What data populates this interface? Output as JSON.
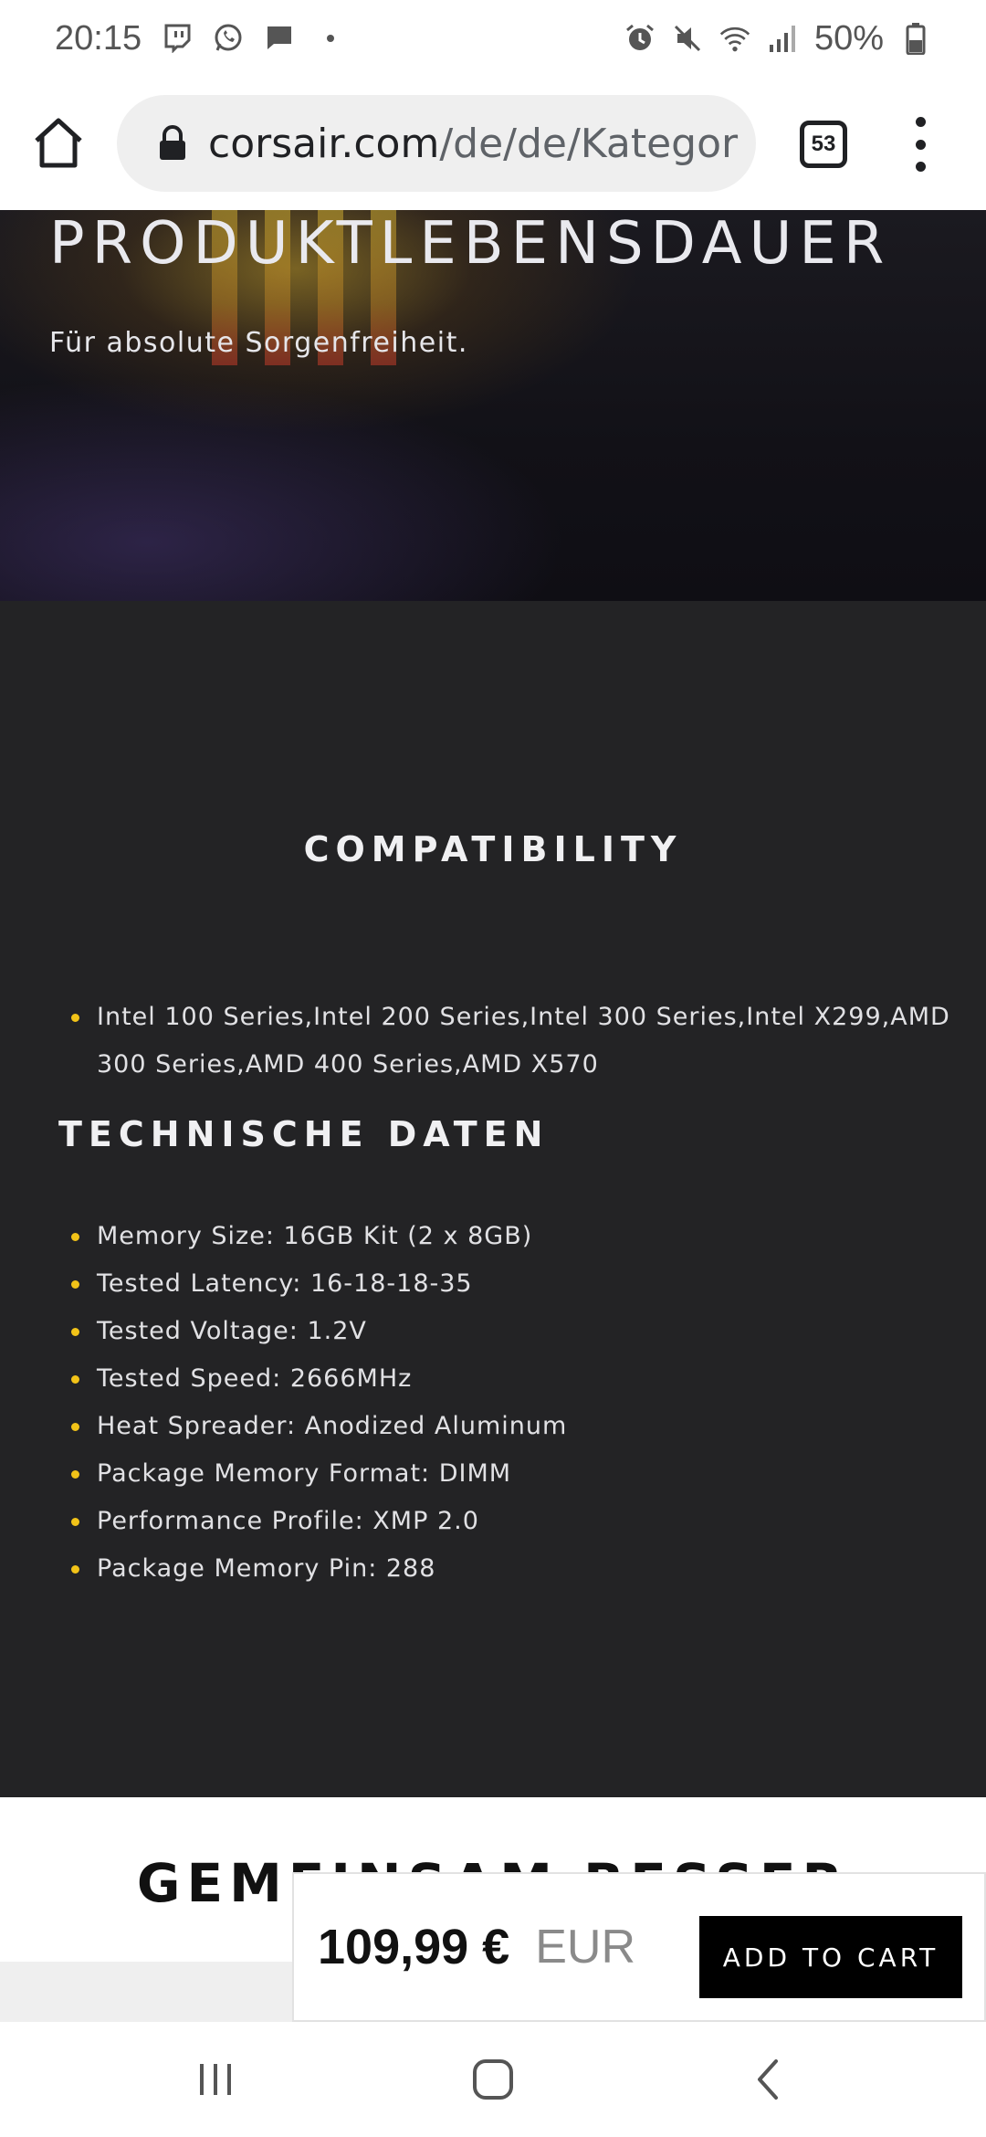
{
  "status_bar": {
    "time": "20:15",
    "battery": "50%",
    "left_icons": [
      "twitch-icon",
      "whatsapp-icon",
      "message-icon",
      "dot-icon"
    ],
    "right_icons": [
      "alarm-icon",
      "mute-icon",
      "wifi-icon",
      "signal-icon",
      "battery-icon"
    ]
  },
  "browser": {
    "url_domain": "corsair.com",
    "url_path": "/de/de/Kategor",
    "tab_count": "53"
  },
  "hero": {
    "title": "PRODUKTLEBENSDAUER",
    "subtitle": "Für absolute Sorgenfreiheit."
  },
  "compatibility": {
    "title": "COMPATIBILITY",
    "items": [
      "Intel 100 Series,Intel 200 Series,Intel 300 Series,Intel X299,AMD 300 Series,AMD 400 Series,AMD X570"
    ]
  },
  "tech_specs": {
    "title": "TECHNISCHE DATEN",
    "items": [
      "Memory Size: 16GB Kit (2 x 8GB)",
      "Tested Latency: 16-18-18-35",
      "Tested Voltage: 1.2V",
      "Tested Speed: 2666MHz",
      "Heat Spreader: Anodized Aluminum",
      "Package Memory Format: DIMM",
      "Performance Profile: XMP 2.0",
      "Package Memory Pin: 288"
    ]
  },
  "together": {
    "title": "GEMEINSAM BESSER"
  },
  "cart": {
    "price": "109,99 €",
    "currency": "EUR",
    "button_label": "ADD TO CART"
  },
  "colors": {
    "accent_bullet": "#f2c318",
    "section_bg": "#232325",
    "button_bg": "#000000"
  }
}
